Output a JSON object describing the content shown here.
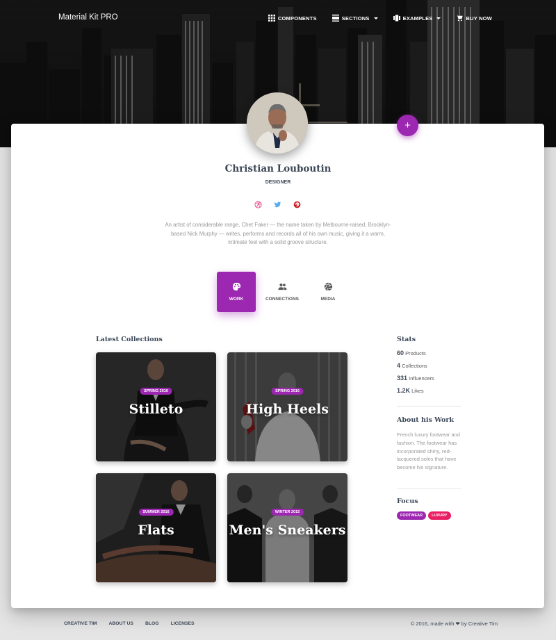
{
  "navbar": {
    "brand": "Material Kit PRO",
    "items": [
      {
        "label": "COMPONENTS",
        "icon": "apps-icon",
        "caret": false
      },
      {
        "label": "SECTIONS",
        "icon": "view-day-icon",
        "caret": true
      },
      {
        "label": "EXAMPLES",
        "icon": "view-carousel-icon",
        "caret": true
      },
      {
        "label": "BUY NOW",
        "icon": "shopping-cart-icon",
        "caret": false
      }
    ]
  },
  "profile": {
    "name": "Christian Louboutin",
    "role": "DESIGNER",
    "bio": "An artist of considerable range, Chet Faker — the name taken by Melbourne-raised, Brooklyn-based Nick Murphy — writes, performs and records all of his own music, giving it a warm, intimate feel with a solid groove structure.",
    "fab_label": "+",
    "socials": [
      "dribbble-icon",
      "twitter-icon",
      "pinterest-icon"
    ]
  },
  "tabs": [
    {
      "label": "WORK",
      "icon": "palette-icon",
      "active": true
    },
    {
      "label": "CONNECTIONS",
      "icon": "people-icon",
      "active": false
    },
    {
      "label": "MEDIA",
      "icon": "camera-icon",
      "active": false
    }
  ],
  "collections": {
    "title": "Latest Collections",
    "items": [
      {
        "badge": "SPRING 2016",
        "title": "Stilleto"
      },
      {
        "badge": "SPRING 2016",
        "title": "High Heels"
      },
      {
        "badge": "SUMMER 2016",
        "title": "Flats"
      },
      {
        "badge": "WINTER 2015",
        "title": "Men's Sneakers"
      }
    ]
  },
  "sidebar": {
    "stats_title": "Stats",
    "stats": [
      {
        "value": "60",
        "label": "Products"
      },
      {
        "value": "4",
        "label": "Collections"
      },
      {
        "value": "331",
        "label": "Influencers"
      },
      {
        "value": "1.2K",
        "label": "Likes"
      }
    ],
    "about_title": "About his Work",
    "about_text": "French luxury footwear and fashion. The footwear has incorporated shiny, red-lacquered soles that have become his signature.",
    "focus_title": "Focus",
    "tags": [
      {
        "label": "FOOTWEAR",
        "color": "#9c27b0"
      },
      {
        "label": "LUXURY",
        "color": "#e91e63"
      }
    ]
  },
  "footer": {
    "links": [
      "CREATIVE TIM",
      "ABOUT US",
      "BLOG",
      "LICENSES"
    ],
    "copyright_pre": "© 2016, made with",
    "copyright_post": "by Creative Tim"
  },
  "colors": {
    "accent": "#9c27b0",
    "dribbble": "#ea4c89",
    "twitter": "#55acee",
    "pinterest": "#cc2127"
  }
}
